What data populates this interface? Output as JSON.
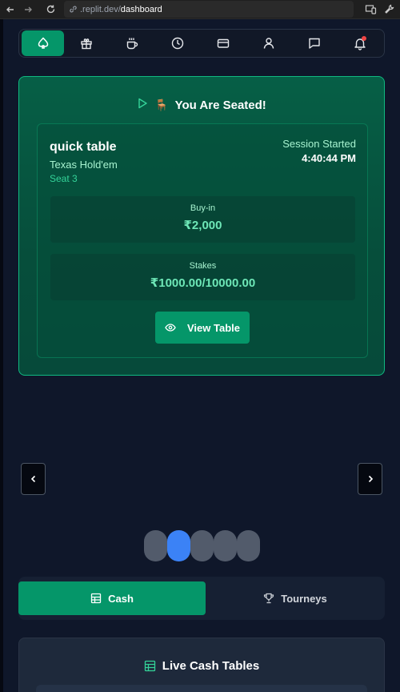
{
  "browser": {
    "url_domain": ".replit.dev/",
    "url_path": "dashboard"
  },
  "nav": {
    "items": [
      "home",
      "rewards",
      "cafe",
      "history",
      "wallet",
      "profile",
      "chat",
      "notifications"
    ],
    "active": "home"
  },
  "seated": {
    "title": "You Are Seated!",
    "table_name": "quick table",
    "game_type": "Texas Hold'em",
    "seat": "Seat 3",
    "session_label": "Session Started",
    "session_time": "4:40:44 PM",
    "buyin_label": "Buy-in",
    "buyin_value": "₹2,000",
    "stakes_label": "Stakes",
    "stakes_value": "₹1000.00/10000.00",
    "view_button": "View Table"
  },
  "carousel": {
    "dot_count": 5,
    "active_dot": 1
  },
  "tabs": {
    "cash": "Cash",
    "tourneys": "Tourneys",
    "active": "cash"
  },
  "live": {
    "title": "Live Cash Tables"
  },
  "colors": {
    "accent": "#059669",
    "accent_light": "#34d399",
    "background": "#0f172a",
    "dot_active": "#3b82f6",
    "notification": "#ef4444"
  }
}
